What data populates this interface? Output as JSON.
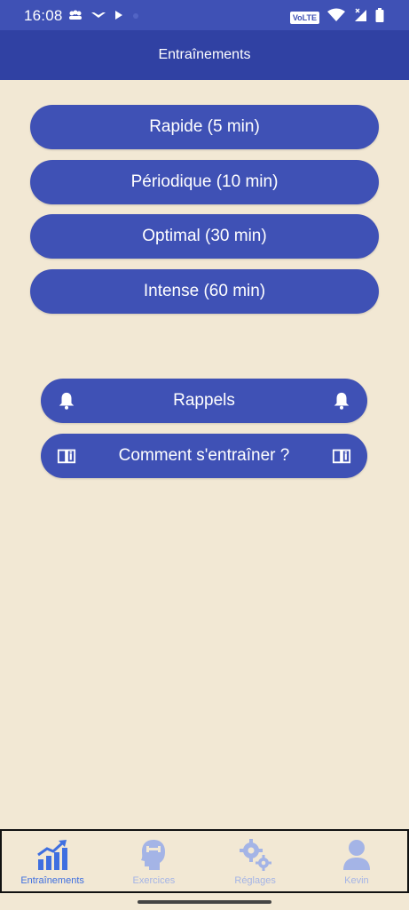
{
  "status_bar": {
    "time": "16:08",
    "volte": "VoLTE"
  },
  "app_bar": {
    "title": "Entraînements"
  },
  "workouts": [
    {
      "label": "Rapide (5 min)"
    },
    {
      "label": "Périodique (10 min)"
    },
    {
      "label": "Optimal (30 min)"
    },
    {
      "label": "Intense (60 min)"
    }
  ],
  "actions": {
    "reminders_label": "Rappels",
    "howto_label": "Comment s'entraîner ?"
  },
  "bottom_nav": {
    "items": [
      {
        "label": "Entraînements",
        "icon": "bar-chart-trend-icon",
        "active": true
      },
      {
        "label": "Exercices",
        "icon": "brain-head-icon",
        "active": false
      },
      {
        "label": "Réglages",
        "icon": "gears-icon",
        "active": false
      },
      {
        "label": "Kevin",
        "icon": "user-icon",
        "active": false
      }
    ]
  },
  "colors": {
    "primary": "#3f51b5",
    "primary_dark": "#3041a3",
    "background": "#f2e8d4",
    "nav_active": "#3f6fe0",
    "nav_inactive": "#a4b4e6"
  }
}
